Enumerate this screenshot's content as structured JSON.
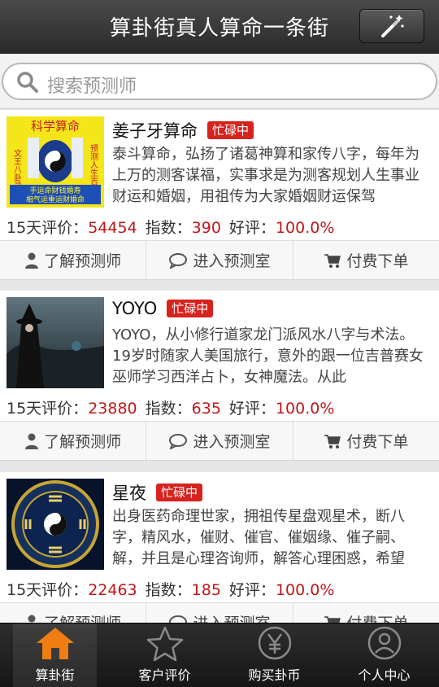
{
  "header": {
    "title": "算卦街真人算命一条街",
    "magic_icon": "magic-wand-icon"
  },
  "search": {
    "placeholder": "搜索预测师"
  },
  "stats_labels": {
    "reviews": "15天评价：",
    "index": "指数：",
    "rating": "好评："
  },
  "actions": {
    "about": "了解预测师",
    "enter": "进入预测室",
    "order": "付费下单"
  },
  "masters": [
    {
      "name": "姜子牙算命",
      "badge": "忙碌中",
      "description": "泰斗算命，弘扬了诸葛神算和家传八字，每年为上万的测客谋福，实事求是为测客规划人生事业财运和婚姻，用祖传为大家婚姻财运保驾",
      "thumb": {
        "top_text": "科学算命",
        "left_text": "文王八卦灵验",
        "right_text": "预测人生吉和",
        "bottom_line1": "手运命财钱婚寿",
        "bottom_line2": "相气运重运财婚命"
      },
      "reviews": "54454",
      "index": "390",
      "rating": "100.0%"
    },
    {
      "name": "YOYO",
      "badge": "忙碌中",
      "description": "YOYO，从小修行道家龙门派风水八字与术法。19岁时随家人美国旅行，意外的跟一位吉普赛女巫师学习西洋占卜，女神魔法。从此",
      "reviews": "23880",
      "index": "635",
      "rating": "100.0%"
    },
    {
      "name": "星夜",
      "badge": "忙碌中",
      "description": "出身医药命理世家，拥祖传星盘观星术，断八字，精风水，催财、催官、催姻缘、催子嗣、解，并且是心理咨询师，解答心理困惑，希望",
      "reviews": "22463",
      "index": "185",
      "rating": "100.0%"
    }
  ],
  "tabs": [
    {
      "label": "算卦街",
      "icon": "home-icon",
      "active": true
    },
    {
      "label": "客户评价",
      "icon": "star-icon",
      "active": false
    },
    {
      "label": "购买卦币",
      "icon": "yen-coin-icon",
      "active": false
    },
    {
      "label": "个人中心",
      "icon": "user-icon",
      "active": false
    }
  ],
  "colors": {
    "badge": "#d7221e",
    "value": "#c0161a",
    "home_icon": "#f07d12"
  }
}
